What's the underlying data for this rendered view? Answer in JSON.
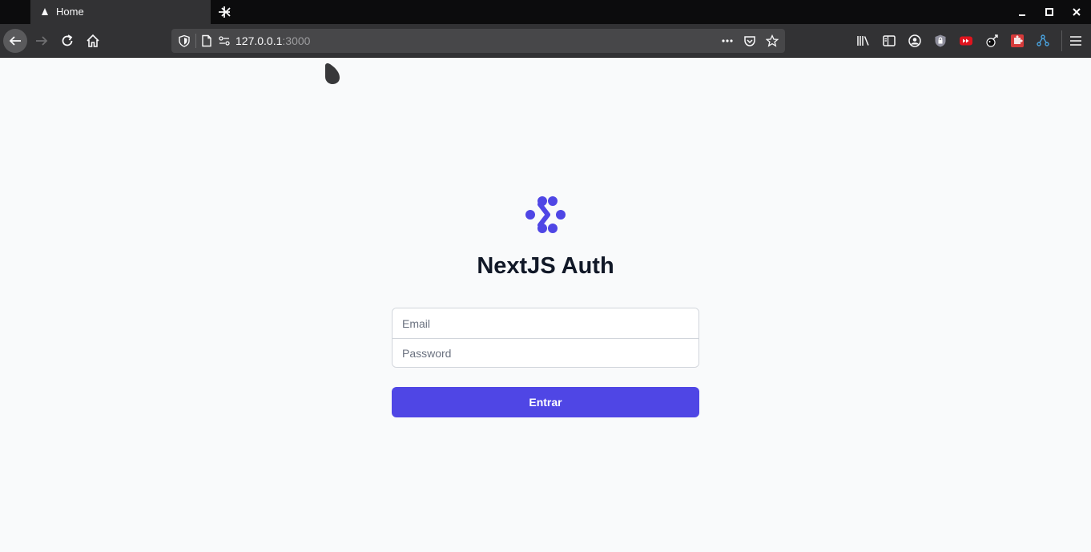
{
  "browser": {
    "tab": {
      "title": "Home"
    },
    "url": {
      "host": "127.0.0.1",
      "port": ":3000"
    }
  },
  "page": {
    "title": "NextJS Auth",
    "form": {
      "email_placeholder": "Email",
      "email_value": "",
      "password_placeholder": "Password",
      "password_value": "",
      "submit_label": "Entrar"
    }
  },
  "colors": {
    "accent": "#4f46e5",
    "heading": "#111827",
    "background": "#f9fafb",
    "chrome_dark": "#0c0c0d",
    "chrome": "#323234"
  },
  "icons": {
    "tabstrip": [
      "tab-favicon",
      "close-icon",
      "plus-icon",
      "minimize-icon",
      "maximize-icon",
      "window-close-icon"
    ],
    "navbar": [
      "back-arrow-icon",
      "forward-arrow-icon",
      "reload-icon",
      "home-icon",
      "shield-icon",
      "page-icon",
      "permissions-icon",
      "more-dots-icon",
      "pocket-icon",
      "star-icon",
      "library-icon",
      "sidebar-icon",
      "account-icon",
      "extension-shield-icon",
      "extension-red-icon",
      "extension-black-icon",
      "extension-puzzle-icon",
      "extension-network-icon",
      "hamburger-menu-icon"
    ],
    "page": [
      "nextjs-auth-logo"
    ]
  }
}
